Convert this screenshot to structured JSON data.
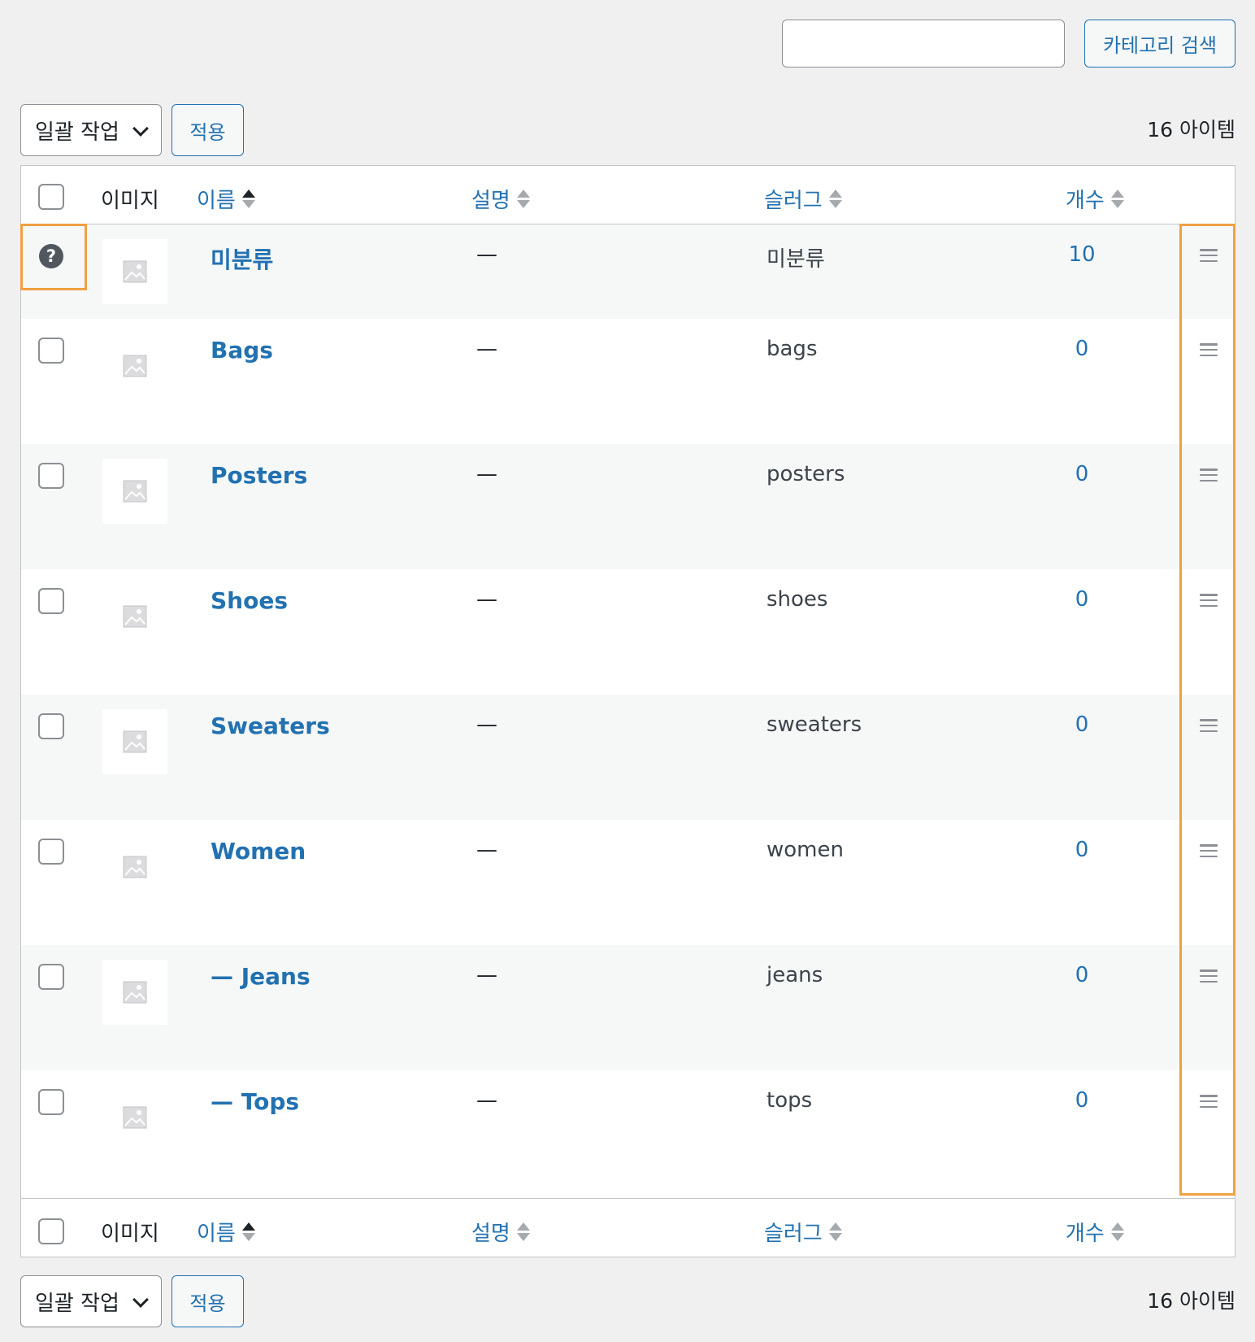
{
  "search": {
    "placeholder": "",
    "button_label": "카테고리 검색"
  },
  "tablenav": {
    "bulk_action_label": "일괄 작업",
    "apply_label": "적용",
    "count_label": "16 아이템"
  },
  "columns": {
    "image": "이미지",
    "name": "이름",
    "description": "설명",
    "slug": "슬러그",
    "count": "개수"
  },
  "rows": [
    {
      "name": "미분류",
      "description": "—",
      "slug": "미분류",
      "count": "10"
    },
    {
      "name": "Bags",
      "description": "—",
      "slug": "bags",
      "count": "0"
    },
    {
      "name": "Posters",
      "description": "—",
      "slug": "posters",
      "count": "0"
    },
    {
      "name": "Shoes",
      "description": "—",
      "slug": "shoes",
      "count": "0"
    },
    {
      "name": "Sweaters",
      "description": "—",
      "slug": "sweaters",
      "count": "0"
    },
    {
      "name": "Women",
      "description": "—",
      "slug": "women",
      "count": "0"
    },
    {
      "name": "— Jeans",
      "description": "—",
      "slug": "jeans",
      "count": "0"
    },
    {
      "name": "— Tops",
      "description": "—",
      "slug": "tops",
      "count": "0"
    }
  ],
  "help_icon_glyph": "?",
  "colors": {
    "link": "#2271b1",
    "highlight": "#f0a042",
    "row_alt": "#f6f7f7"
  }
}
